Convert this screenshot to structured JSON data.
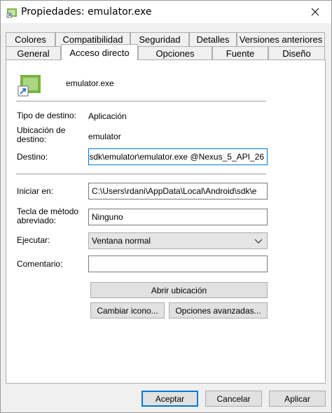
{
  "window": {
    "title": "Propiedades: emulator.exe",
    "close_icon": "close-icon"
  },
  "tabs": {
    "row1": [
      {
        "label": "Colores"
      },
      {
        "label": "Compatibilidad"
      },
      {
        "label": "Seguridad"
      },
      {
        "label": "Detalles"
      },
      {
        "label": "Versiones anteriores"
      }
    ],
    "row2": [
      {
        "label": "General"
      },
      {
        "label": "Acceso directo"
      },
      {
        "label": "Opciones"
      },
      {
        "label": "Fuente"
      },
      {
        "label": "Diseño"
      }
    ],
    "active": "Acceso directo"
  },
  "shortcut": {
    "name": "emulator.exe",
    "target_type_label": "Tipo de destino:",
    "target_type_value": "Aplicación",
    "target_location_label": "Ubicación de destino:",
    "target_location_value": "emulator",
    "target_label": "Destino:",
    "target_value": "sdk\\emulator\\emulator.exe @Nexus_5_API_26",
    "start_in_label": "Iniciar en:",
    "start_in_value": "C:\\Users\\rdani\\AppData\\Local\\Android\\sdk\\e",
    "hotkey_label": "Tecla de método abreviado:",
    "hotkey_value": "Ninguno",
    "run_label": "Ejecutar:",
    "run_value": "Ventana normal",
    "comment_label": "Comentario:",
    "comment_value": ""
  },
  "buttons": {
    "open_location": "Abrir ubicación",
    "change_icon": "Cambiar icono...",
    "advanced": "Opciones avanzadas...",
    "ok": "Aceptar",
    "cancel": "Cancelar",
    "apply": "Aplicar"
  },
  "colors": {
    "focus_blue": "#0078d7",
    "icon_green": "#4caf50"
  }
}
